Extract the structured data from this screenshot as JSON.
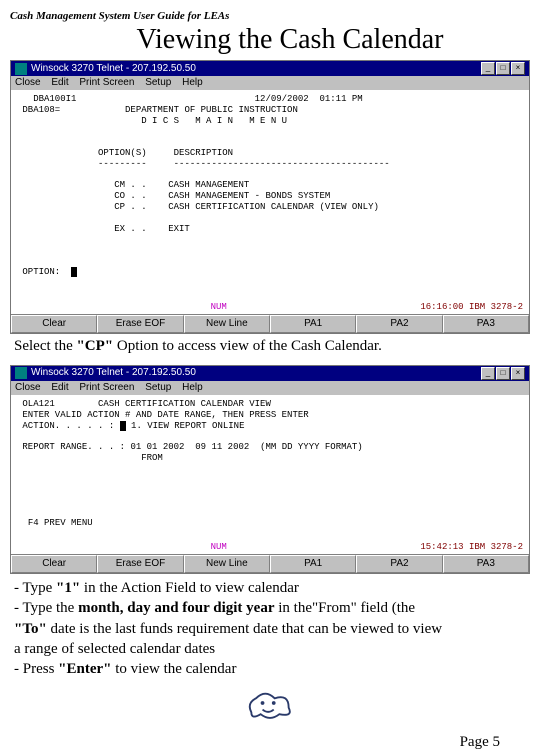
{
  "doc": {
    "header_small": "Cash Management System User Guide for LEAs",
    "title": "Viewing the Cash Calendar",
    "page_label": "Page  5"
  },
  "window1": {
    "title": "Winsock 3270 Telnet - 207.192.50.50",
    "menus": [
      "Close",
      "Edit",
      "Print Screen",
      "Setup",
      "Help"
    ],
    "screen": {
      "header_code": "DBA100I1",
      "date_time": "12/09/2002  01:11 PM",
      "agency": "DBA108=",
      "dept_line": "DEPARTMENT OF PUBLIC INSTRUCTION",
      "menu_title": "D I C S   M A I N   M E N U",
      "col1": "OPTION(S)",
      "col2": "DESCRIPTION",
      "dash1": "---------",
      "dash2": "----------------------------------------",
      "rows": [
        {
          "code": "CM . .",
          "desc": "CASH MANAGEMENT"
        },
        {
          "code": "CO . .",
          "desc": "CASH MANAGEMENT - BONDS SYSTEM"
        },
        {
          "code": "CP . .",
          "desc": "CASH CERTIFICATION CALENDAR (VIEW ONLY)"
        },
        {
          "code": "EX . .",
          "desc": "EXIT"
        }
      ],
      "prompt": "OPTION:",
      "status_num": "NUM",
      "status_right": "16:16:00 IBM 3278-2"
    },
    "fn": [
      "Clear",
      "Erase EOF",
      "New Line",
      "PA1",
      "PA2",
      "PA3"
    ]
  },
  "instruction1_pre": "Select the ",
  "instruction1_bold": "\"CP\"",
  "instruction1_post": "  Option to access view of the Cash Calendar.",
  "window2": {
    "title": "Winsock 3270 Telnet - 207.192.50.50",
    "menus": [
      "Close",
      "Edit",
      "Print Screen",
      "Setup",
      "Help"
    ],
    "screen": {
      "header_code": "OLA121",
      "menu_title": "CASH CERTIFICATION CALENDAR VIEW",
      "line1": "ENTER VALID ACTION # AND DATE RANGE, THEN PRESS ENTER",
      "action_label": "ACTION. . . . . :",
      "action_value": "1",
      "action_desc": "1. VIEW REPORT ONLINE",
      "range_label": "REPORT RANGE. . . :",
      "range_from": "01 01 2002",
      "range_to": "09 11 2002",
      "range_fmt": "(MM DD YYYY FORMAT)",
      "from_tag": "FROM",
      "footer_hint": "F4 PREV MENU",
      "status_num": "NUM",
      "status_right": "15:42:13 IBM 3278-2"
    },
    "fn": [
      "Clear",
      "Erase EOF",
      "New Line",
      "PA1",
      "PA2",
      "PA3"
    ]
  },
  "bullets": {
    "l1_pre": "- Type ",
    "l1_bold": "\"1\"",
    "l1_post": " in the Action Field to view calendar",
    "l2_pre": "- Type  the ",
    "l2_bold": "month, day and  four digit year",
    "l2_post": " in the\"From\" field (the",
    "l3_bold": "\"To\"",
    "l3_post": " date is the last funds requirement date that can be viewed to view",
    "l4": "a range of selected calendar dates",
    "l5_pre": "- Press ",
    "l5_bold": "\"Enter\"",
    "l5_post": "  to view the calendar"
  }
}
